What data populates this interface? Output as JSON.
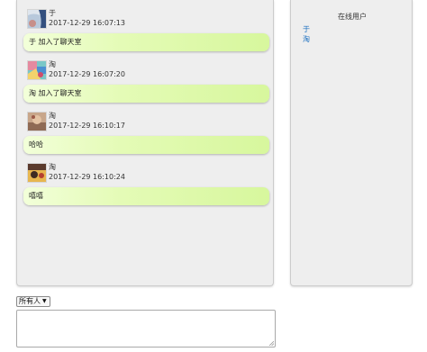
{
  "users_panel": {
    "title": "在线用户",
    "users": [
      "于",
      "淘"
    ]
  },
  "messages": [
    {
      "name": "于",
      "time": "2017-12-29 16:07:13",
      "text": "于 加入了聊天室"
    },
    {
      "name": "淘",
      "time": "2017-12-29 16:07:20",
      "text": "淘 加入了聊天室"
    },
    {
      "name": "淘",
      "time": "2017-12-29 16:10:17",
      "text": "哈哈"
    },
    {
      "name": "淘",
      "time": "2017-12-29 16:10:24",
      "text": "嘻嘻"
    }
  ],
  "composer": {
    "recipient": "所有人",
    "message": ""
  },
  "colors": {
    "bubble_start": "#f2ffd9",
    "bubble_end": "#d7f79d",
    "user_link": "#1a6fc0",
    "panel_bg": "#eeeeee"
  }
}
